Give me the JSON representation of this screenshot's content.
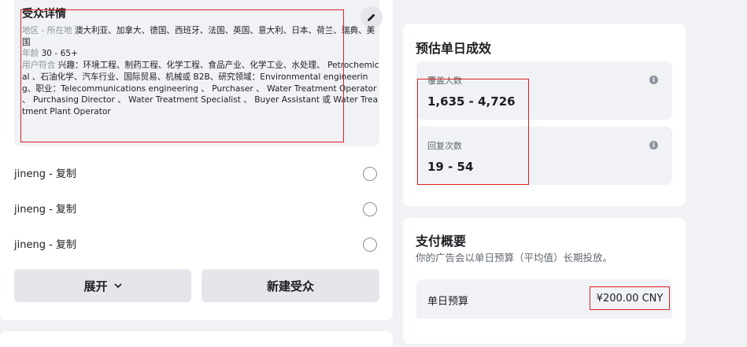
{
  "audience_card": {
    "title": "受众详情",
    "location_label": "地区 - 所在地",
    "location_value": "澳大利亚、加拿大、德国、西班牙、法国、英国、意大利、日本、荷兰、瑞典、美国",
    "age_label": "年龄",
    "age_value": "30 - 65+",
    "match_label": "用户符合",
    "match_value": "兴趣：环境工程、制药工程、化学工程、食品产业、化学工业、水处理、 Petrochemical 、石油化学、汽车行业、国际贸易、机械或 B2B、研究领域：Environmental engineering、职业：Telecommunications engineering 、 Purchaser 、 Water Treatment Operator 、 Purchasing Director 、 Water Treatment Specialist 、 Buyer Assistant 或 Water Treatment Plant Operator"
  },
  "saved_audiences": [
    {
      "label": "jineng - 复制"
    },
    {
      "label": "jineng - 复制"
    },
    {
      "label": "jineng - 复制"
    }
  ],
  "buttons": {
    "expand": "展开",
    "new_audience": "新建受众"
  },
  "estimate": {
    "title": "预估单日成效",
    "reach_label": "覆盖人数",
    "reach_value": "1,635 - 4,726",
    "replies_label": "回复次数",
    "replies_value": "19 - 54"
  },
  "payment": {
    "title": "支付概要",
    "subtitle": "你的广告会以单日预算（平均值）长期投放。",
    "daily_budget_label": "单日预算",
    "daily_budget_value": "¥200.00 CNY"
  },
  "icons": {
    "edit": "pencil-icon",
    "info": "info-icon",
    "expand": "chevron-down-icon"
  },
  "colors": {
    "highlight": "#e02020",
    "panel": "#ffffff",
    "background": "#f0f2f5"
  }
}
